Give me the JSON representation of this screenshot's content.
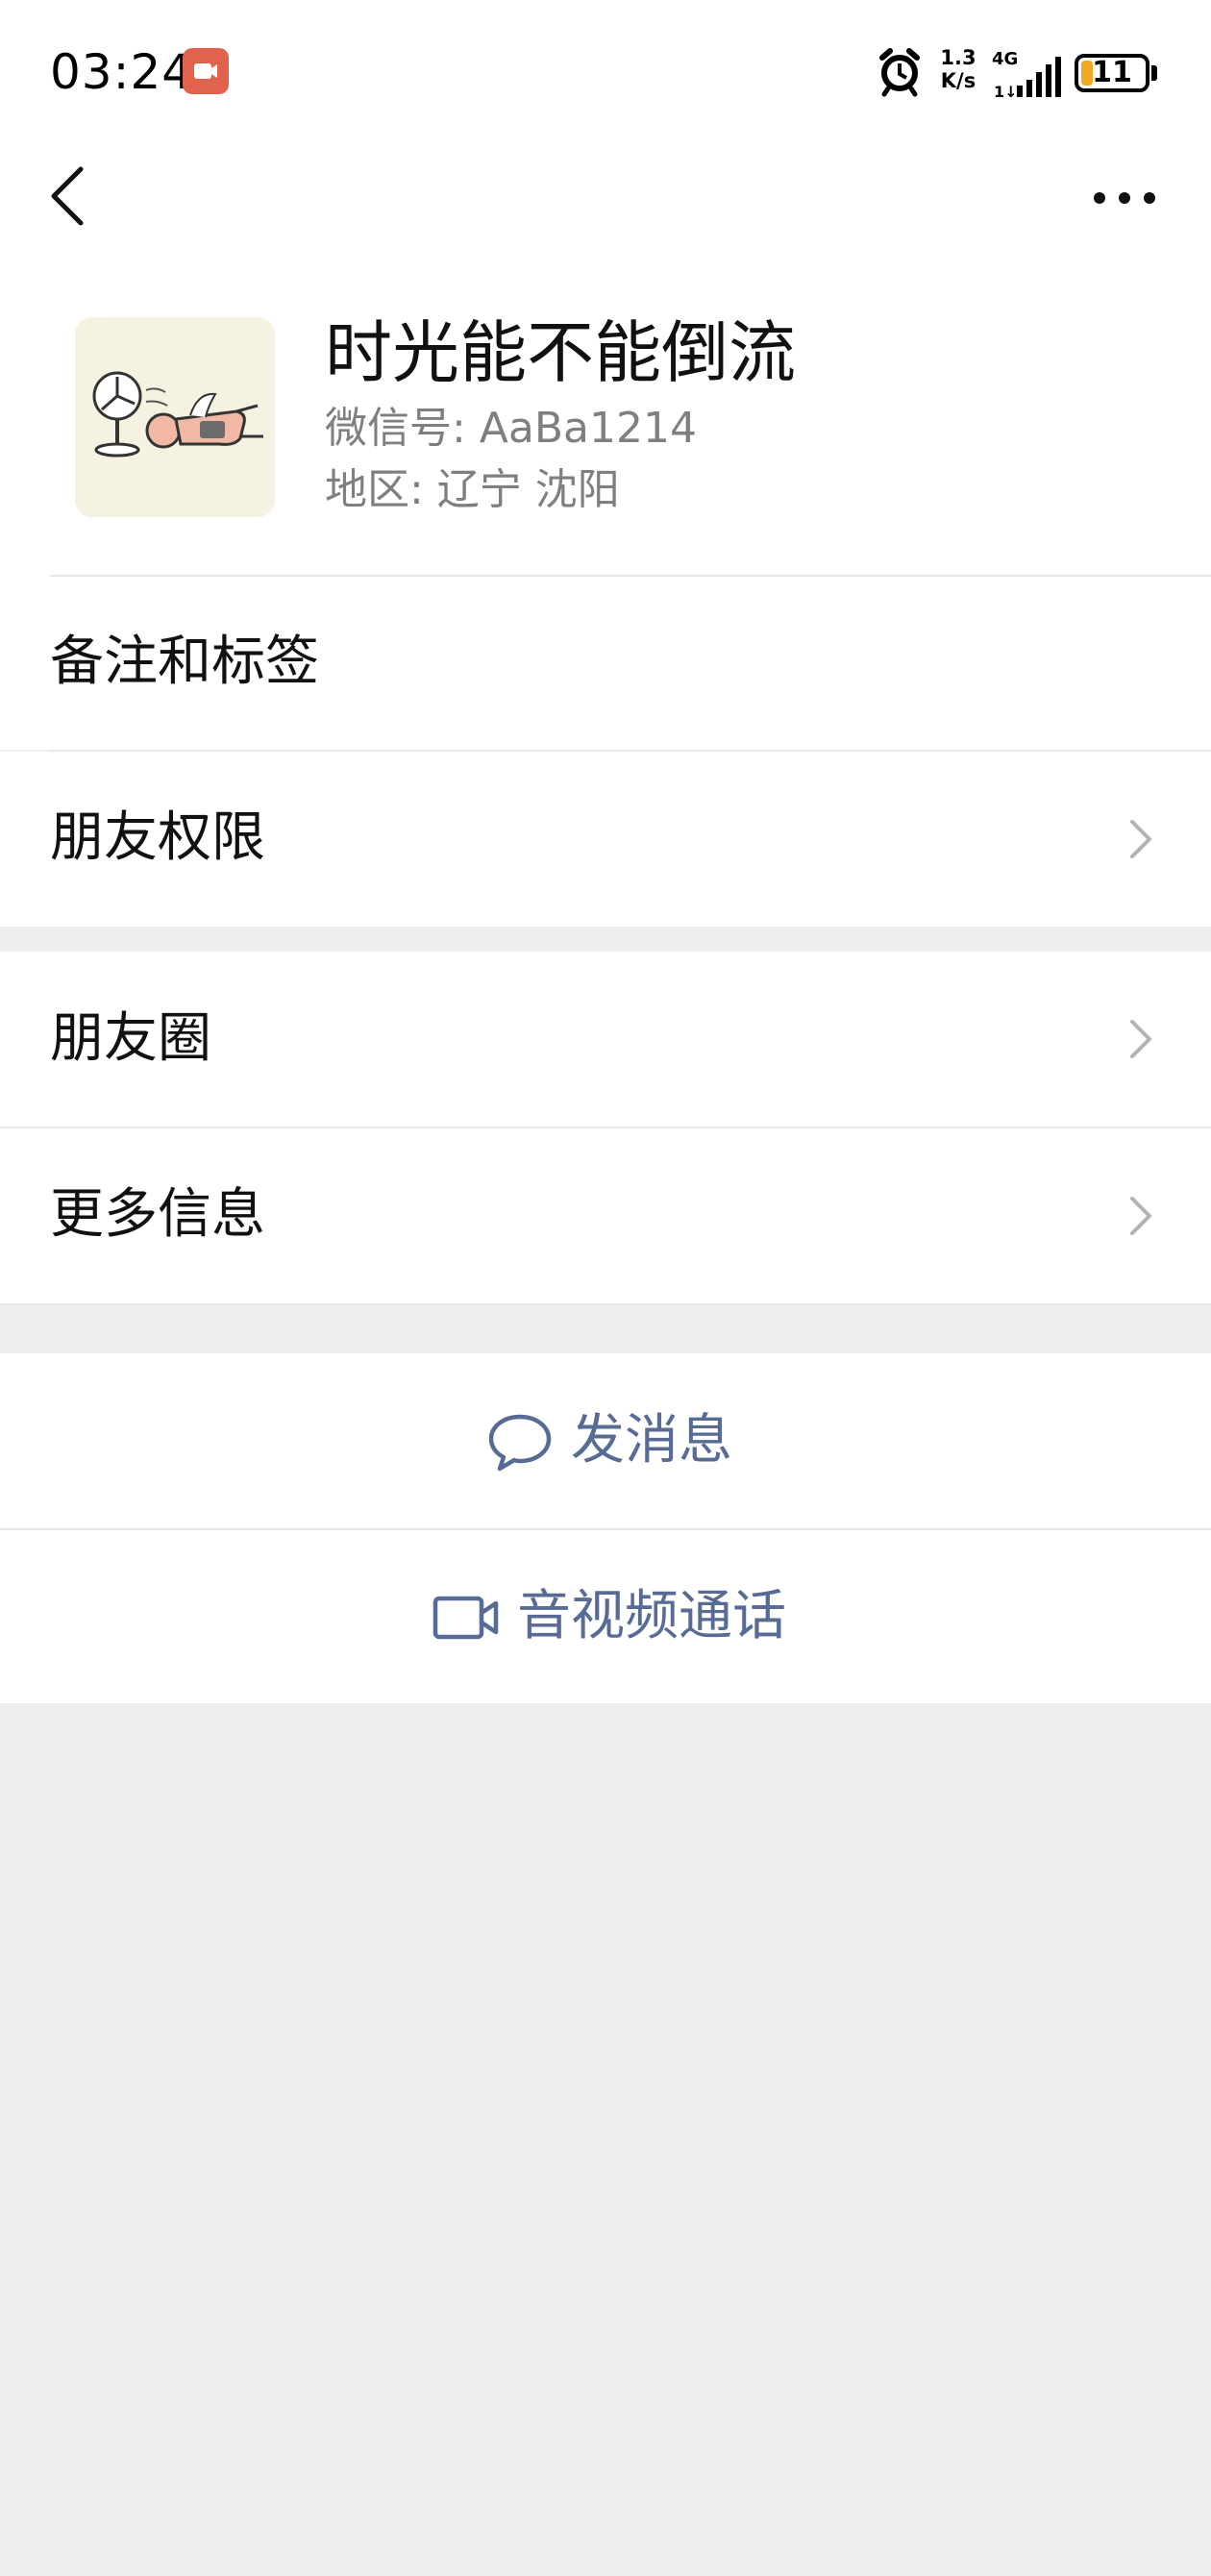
{
  "status_bar": {
    "time": "03:24",
    "net_speed_value": "1.3",
    "net_speed_unit": "K/s",
    "network": "4G",
    "battery": "11",
    "icons": [
      "screen-record-icon",
      "alarm-icon",
      "signal-icon",
      "battery-icon"
    ]
  },
  "nav": {
    "back_icon": "chevron-left-icon",
    "more_icon": "more-dots-icon"
  },
  "profile": {
    "nickname": "时光能不能倒流",
    "wechat_id": "微信号: AaBa1214",
    "region": "地区: 辽宁 沈阳"
  },
  "menu": {
    "remark_tags": "备注和标签",
    "friend_permissions": "朋友权限",
    "moments": "朋友圈",
    "more_info": "更多信息"
  },
  "actions": {
    "send_message": "发消息",
    "video_call": "音视频通话"
  },
  "colors": {
    "background": "#ededed",
    "link_blue": "#576b95",
    "battery_low": "#f5a623",
    "record_badge": "#e2634d"
  }
}
